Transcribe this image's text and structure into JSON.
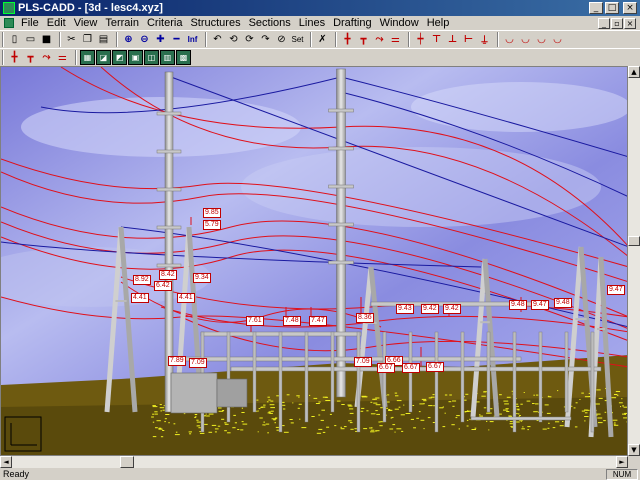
{
  "window": {
    "title": "PLS-CADD - [3d - lesc4.xyz]",
    "minimize_glyph": "_",
    "maximize_glyph": "□",
    "close_glyph": "×"
  },
  "menu": {
    "items": [
      "File",
      "Edit",
      "View",
      "Terrain",
      "Criteria",
      "Structures",
      "Sections",
      "Lines",
      "Drafting",
      "Window",
      "Help"
    ],
    "mdi_minimize": "_",
    "mdi_restore": "▫",
    "mdi_close": "×"
  },
  "toolbar": {
    "row1": [
      {
        "name": "new-file-icon",
        "glyph": "▯"
      },
      {
        "name": "open-folder-icon",
        "glyph": "▭"
      },
      {
        "name": "save-icon",
        "glyph": "■"
      },
      {
        "name": "cut-icon",
        "glyph": "✂"
      },
      {
        "name": "copy-icon",
        "glyph": "❐"
      },
      {
        "name": "paste-icon",
        "glyph": "▤"
      },
      {
        "name": "zoom-in-icon",
        "glyph": "⊕"
      },
      {
        "name": "zoom-out-icon",
        "glyph": "⊖"
      },
      {
        "name": "zoom-plus-icon",
        "glyph": "✚"
      },
      {
        "name": "zoom-minus-icon",
        "glyph": "━"
      },
      {
        "name": "zoom-infinite-label",
        "glyph": "Inf"
      },
      {
        "name": "rotate-left-icon",
        "glyph": "↶"
      },
      {
        "name": "rotate-up-icon",
        "glyph": "⟲"
      },
      {
        "name": "rotate-down-icon",
        "glyph": "⟳"
      },
      {
        "name": "rotate-right-icon",
        "glyph": "↷"
      },
      {
        "name": "rotate-center-icon",
        "glyph": "⊘"
      },
      {
        "name": "set-view-label",
        "glyph": "Set"
      },
      {
        "name": "pick-tool-icon",
        "glyph": "✗"
      },
      {
        "name": "structure-add-icon",
        "glyph": "╋"
      },
      {
        "name": "structure-move-icon",
        "glyph": "┳"
      },
      {
        "name": "structure-edit-icon",
        "glyph": "⤳"
      },
      {
        "name": "structure-delete-icon",
        "glyph": "⚌"
      },
      {
        "name": "section-add-icon",
        "glyph": "┿"
      },
      {
        "name": "section-edit-icon",
        "glyph": "⊤"
      },
      {
        "name": "section-sag-icon",
        "glyph": "⊥"
      },
      {
        "name": "section-tension-icon",
        "glyph": "⊢"
      },
      {
        "name": "section-check-icon",
        "glyph": "⍊"
      },
      {
        "name": "sag-view-1-icon",
        "glyph": "◡"
      },
      {
        "name": "sag-view-2-icon",
        "glyph": "◡"
      },
      {
        "name": "sag-view-3-icon",
        "glyph": "◡"
      },
      {
        "name": "sag-view-4-icon",
        "glyph": "◡"
      }
    ],
    "row2": [
      {
        "name": "line-tool-1-icon",
        "glyph": "╋"
      },
      {
        "name": "line-tool-2-icon",
        "glyph": "┳"
      },
      {
        "name": "line-tool-3-icon",
        "glyph": "⤳"
      },
      {
        "name": "line-tool-4-icon",
        "glyph": "⚌"
      },
      {
        "name": "view-tool-1-icon",
        "glyph": "▦"
      },
      {
        "name": "view-tool-2-icon",
        "glyph": "◪"
      },
      {
        "name": "view-tool-3-icon",
        "glyph": "◩"
      },
      {
        "name": "view-tool-4-icon",
        "glyph": "▣"
      },
      {
        "name": "view-tool-5-icon",
        "glyph": "◫"
      },
      {
        "name": "view-tool-6-icon",
        "glyph": "▥"
      },
      {
        "name": "view-tool-7-icon",
        "glyph": "▩"
      }
    ]
  },
  "viewport": {
    "clearance_labels": [
      "9.85",
      "5.79",
      "8.92",
      "8.42",
      "9.34",
      "6.42",
      "4.41",
      "4.41",
      "7.61",
      "7.48",
      "7.47",
      "8.36",
      "9.43",
      "9.42",
      "9.42",
      "9.48",
      "9.47",
      "9.48",
      "9.47",
      "7.89",
      "7.09",
      "7.09",
      "6.66",
      "6.67",
      "6.67",
      "6.67"
    ],
    "colors": {
      "sky": "#8a8ce0",
      "ground": "#6e5a10",
      "conductor_red": "#e0101a",
      "conductor_blue": "#1a1aa0",
      "vegetation": "#f0f020"
    }
  },
  "status": {
    "text": "Ready",
    "num": "NUM"
  },
  "scroll": {
    "left": "◄",
    "right": "►",
    "up": "▲",
    "down": "▼"
  }
}
